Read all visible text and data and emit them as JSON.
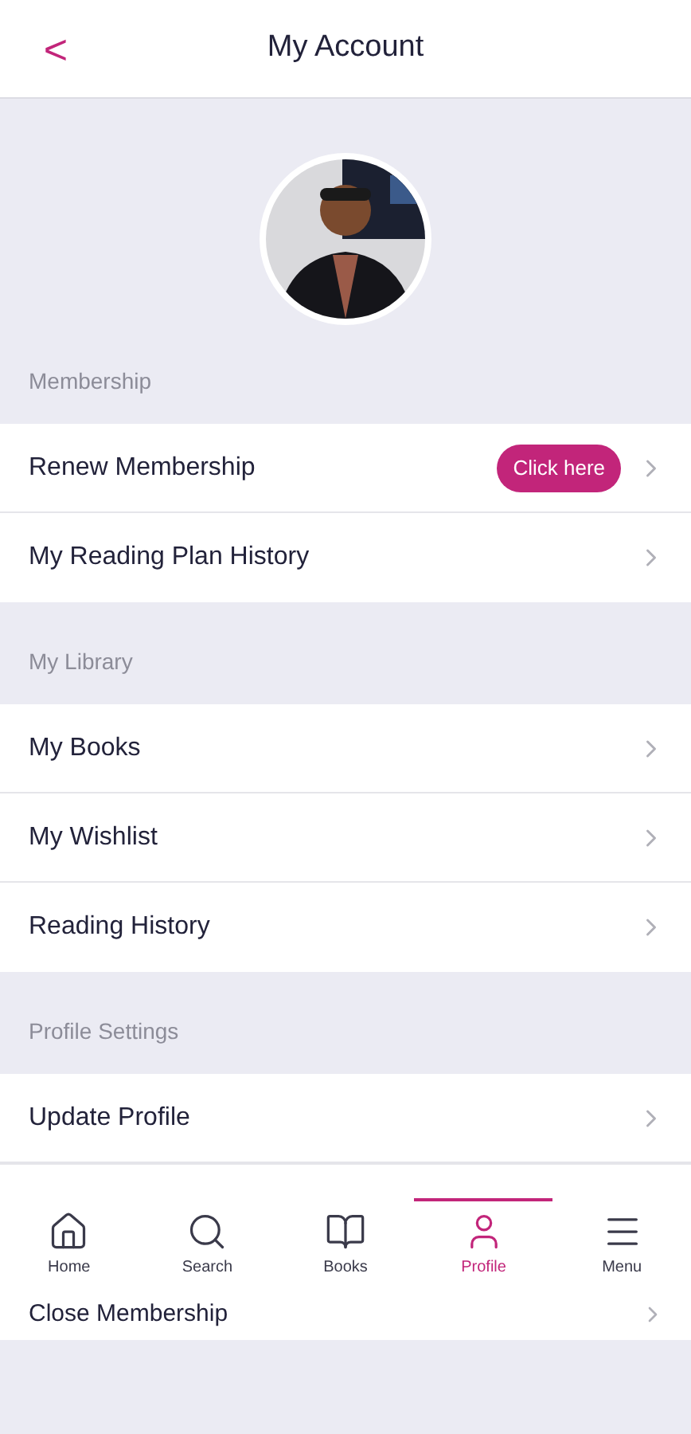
{
  "header": {
    "back": "<",
    "title": "My Account"
  },
  "sections": [
    {
      "title": "Membership",
      "rows": [
        {
          "label": "Renew Membership",
          "action": "Click here"
        },
        {
          "label": "My Reading Plan History"
        }
      ]
    },
    {
      "title": "My Library",
      "rows": [
        {
          "label": "My Books"
        },
        {
          "label": "My Wishlist"
        },
        {
          "label": "Reading History"
        }
      ]
    },
    {
      "title": "Profile Settings",
      "rows": [
        {
          "label": "Update Profile"
        }
      ]
    }
  ],
  "nav": [
    {
      "label": "Home",
      "selected": false
    },
    {
      "label": "Search",
      "selected": false
    },
    {
      "label": "Books",
      "selected": false
    },
    {
      "label": "Profile",
      "selected": true
    },
    {
      "label": "Menu",
      "selected": false
    }
  ],
  "after_nav_row": {
    "label": "Close Membership"
  }
}
